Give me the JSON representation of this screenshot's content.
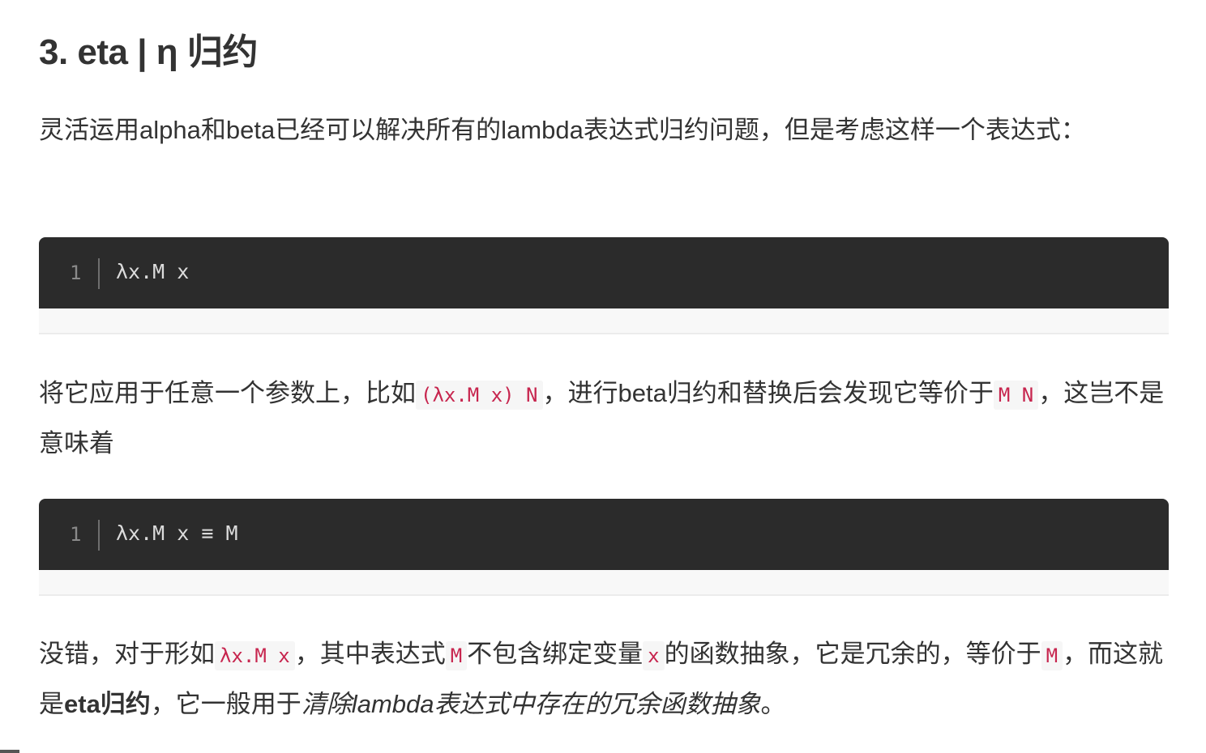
{
  "heading": "3. eta | η 归约",
  "para1": {
    "text": "灵活运用alpha和beta已经可以解决所有的lambda表达式归约问题，但是考虑这样一个表达式："
  },
  "code1": {
    "line_number": "1",
    "code": "λx.M x"
  },
  "para2": {
    "text_a": "将它应用于任意一个参数上，比如",
    "code_a": "(λx.M x) N",
    "text_b": "，进行beta归约和替换后会发现它等价于",
    "code_b": "M N",
    "text_c": "，这岂不是意味着"
  },
  "code2": {
    "line_number": "1",
    "code": "λx.M x ≡ M"
  },
  "para3": {
    "text_a": "没错，对于形如",
    "code_a": "λx.M x",
    "text_b": "，其中表达式",
    "code_b": "M",
    "text_c": "不包含绑定变量",
    "code_c": "x",
    "text_d": "的函数抽象，它是冗余的，等价于",
    "code_d": "M",
    "text_e": "，而这就是",
    "strong": "eta归约",
    "text_f": "，它一般用于",
    "emph": "清除lambda表达式中存在的冗余函数抽象",
    "text_g": "。"
  },
  "colors": {
    "text": "#333333",
    "code_bg": "#2b2b2b",
    "code_text": "#dcdcdc",
    "inline_code": "#c7254e",
    "inline_code_bg": "#f6f6f6"
  }
}
